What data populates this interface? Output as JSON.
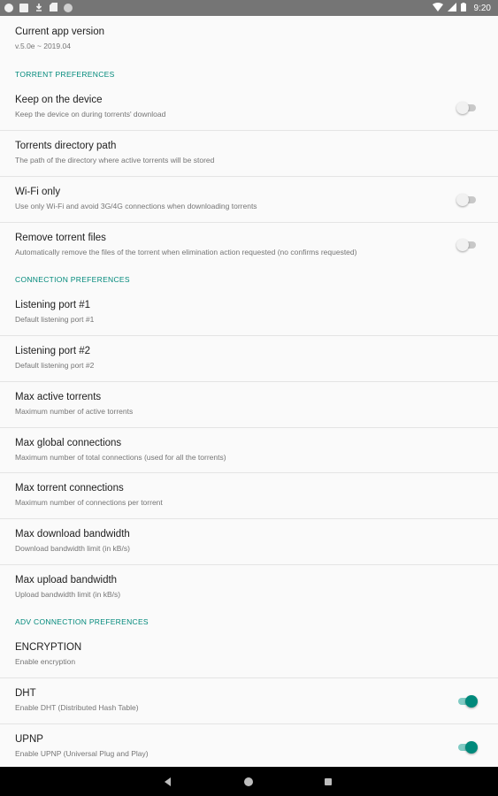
{
  "status_bar": {
    "time": "9:20",
    "left_icons": [
      "check-circle-icon",
      "square-notification-icon",
      "download-icon",
      "sd-card-icon",
      "circle-notification-icon"
    ],
    "right_icons": [
      "wifi-icon",
      "signal-icon",
      "battery-icon"
    ]
  },
  "version": {
    "title": "Current app version",
    "summary": "v.5.0e ~ 2019.04"
  },
  "torrent_prefs": {
    "header": "TORRENT PREFERENCES",
    "items": [
      {
        "title": "Keep on the device",
        "summary": "Keep the device on during torrents' download",
        "toggle": false
      },
      {
        "title": "Torrents directory path",
        "summary": "The path of the directory where active torrents will be stored"
      },
      {
        "title": "Wi-Fi only",
        "summary": "Use only Wi-Fi and avoid 3G/4G connections when downloading torrents",
        "toggle": false
      },
      {
        "title": "Remove torrent files",
        "summary": "Automatically remove the files of the torrent when elimination action requested (no confirms requested)",
        "toggle": false
      }
    ]
  },
  "connection_prefs": {
    "header": "CONNECTION PREFERENCES",
    "items": [
      {
        "title": "Listening port #1",
        "summary": "Default listening port #1"
      },
      {
        "title": "Listening port #2",
        "summary": "Default listening port #2"
      },
      {
        "title": "Max active torrents",
        "summary": "Maximum number of active torrents"
      },
      {
        "title": "Max global connections",
        "summary": "Maximum number of total connections (used for all the torrents)"
      },
      {
        "title": "Max torrent connections",
        "summary": "Maximum number of connections per torrent"
      },
      {
        "title": "Max download bandwidth",
        "summary": "Download bandwidth limit (in kB/s)"
      },
      {
        "title": "Max upload bandwidth",
        "summary": "Upload bandwidth limit (in kB/s)"
      }
    ]
  },
  "adv_prefs": {
    "header": "ADV CONNECTION PREFERENCES",
    "items": [
      {
        "title": "ENCRYPTION",
        "summary": "Enable encryption"
      },
      {
        "title": "DHT",
        "summary": "Enable DHT (Distributed Hash Table)",
        "toggle": true
      },
      {
        "title": "UPNP",
        "summary": "Enable UPNP (Universal Plug and Play)",
        "toggle": true
      }
    ]
  },
  "colors": {
    "accent": "#00897b",
    "status_bar": "#757575",
    "background": "#fafafa",
    "nav_bar": "#000000"
  }
}
